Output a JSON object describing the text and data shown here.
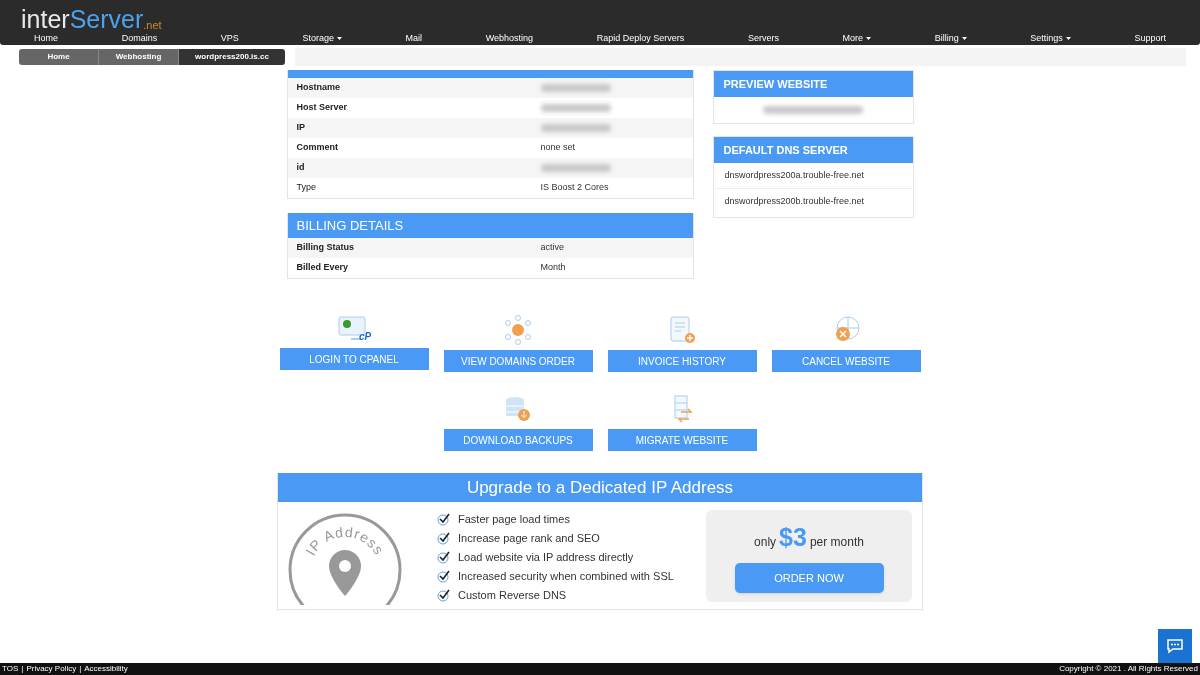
{
  "logo": {
    "part_1": "inter",
    "part_2": "Server",
    "suffix": ".net"
  },
  "nav": [
    {
      "label": "Home",
      "has_menu": false
    },
    {
      "label": "Domains",
      "has_menu": false
    },
    {
      "label": "VPS",
      "has_menu": false
    },
    {
      "label": "Storage",
      "has_menu": true
    },
    {
      "label": "Mail",
      "has_menu": false
    },
    {
      "label": "Webhosting",
      "has_menu": false
    },
    {
      "label": "Rapid Deploy Servers",
      "has_menu": false
    },
    {
      "label": "Servers",
      "has_menu": false
    },
    {
      "label": "More",
      "has_menu": true
    },
    {
      "label": "Billing",
      "has_menu": true
    },
    {
      "label": "Settings",
      "has_menu": true
    },
    {
      "label": "Support",
      "has_menu": false
    }
  ],
  "breadcrumb": [
    {
      "label": "Home",
      "selected": false
    },
    {
      "label": "Webhosting",
      "selected": false
    },
    {
      "label": "wordpress200.is.cc",
      "selected": true
    }
  ],
  "info_table": {
    "rows": [
      {
        "label": "Hostname",
        "label_bold": true,
        "blurred": true
      },
      {
        "label": "Host Server",
        "label_bold": true,
        "blurred": true
      },
      {
        "label": "IP",
        "label_bold": true,
        "blurred": true
      },
      {
        "label": "Comment",
        "label_bold": true,
        "blurred": false,
        "value": "none set"
      },
      {
        "label": "id",
        "label_bold": true,
        "blurred": true
      },
      {
        "label": "Type",
        "label_bold": false,
        "blurred": false,
        "value": "IS Boost 2 Cores"
      }
    ]
  },
  "billing": {
    "title": "BILLING DETAILS",
    "rows": [
      {
        "label": "Billing Status",
        "label_bold": true,
        "blurred": false,
        "value": "active"
      },
      {
        "label": "Billed Every",
        "label_bold": true,
        "blurred": false,
        "value": "Month"
      }
    ]
  },
  "preview": {
    "title": "PREVIEW WEBSITE",
    "url_blurred": true
  },
  "dns": {
    "title": "DEFAULT DNS SERVER",
    "servers": [
      "dnswordpress200a.trouble-free.net",
      "dnswordpress200b.trouble-free.net"
    ]
  },
  "actions": [
    [
      {
        "kind": "cpanel",
        "label": "LOGIN TO CPANEL",
        "icon_text": "cP"
      },
      {
        "kind": "domains",
        "label": "VIEW DOMAINS ORDER"
      },
      {
        "kind": "invoice",
        "label": "INVOICE HISTORY"
      },
      {
        "kind": "cancel",
        "label": "CANCEL WEBSITE"
      }
    ],
    [
      {
        "kind": "backup",
        "label": "DOWNLOAD BACKUPS"
      },
      {
        "kind": "migrate",
        "label": "MIGRATE WEBSITE"
      }
    ]
  ],
  "upgrade": {
    "title": "Upgrade to a Dedicated IP Address",
    "badge_text": "IP Address",
    "features": [
      "Faster page load times",
      "Increase page rank and SEO",
      "Load website via IP address directly",
      "Increased security when combined with SSL",
      "Custom Reverse DNS"
    ],
    "price_prefix": "only",
    "price": "$3",
    "price_suffix": "per month",
    "order_button": "ORDER NOW"
  },
  "footer": {
    "links": [
      "TOS",
      "Privacy Policy",
      "Accessibility"
    ],
    "separators": [
      "|",
      "|"
    ],
    "copyright": "Copyright © 2021 . All Rights Reserved"
  }
}
